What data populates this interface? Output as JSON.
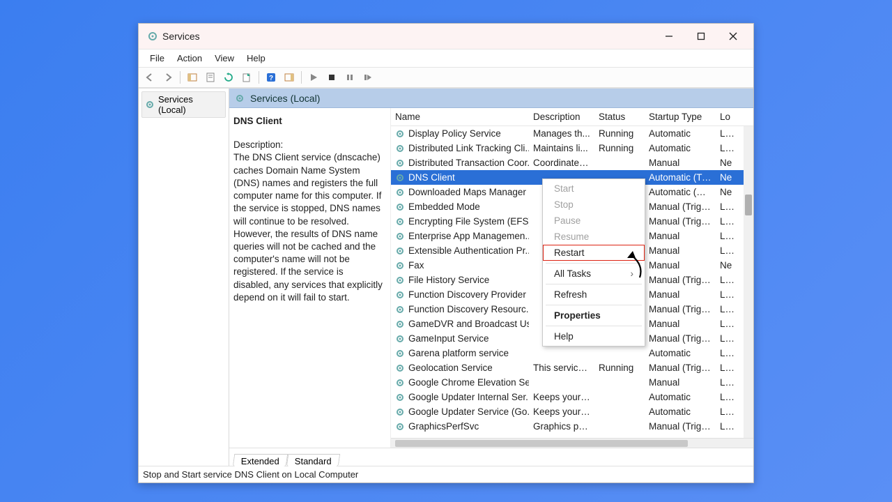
{
  "window": {
    "title": "Services"
  },
  "menus": [
    "File",
    "Action",
    "View",
    "Help"
  ],
  "tree": {
    "root": "Services (Local)"
  },
  "panel": {
    "header": "Services (Local)"
  },
  "detail": {
    "service_name": "DNS Client",
    "desc_label": "Description:",
    "description": "The DNS Client service (dnscache) caches Domain Name System (DNS) names and registers the full computer name for this computer. If the service is stopped, DNS names will continue to be resolved. However, the results of DNS name queries will not be cached and the computer's name will not be registered. If the service is disabled, any services that explicitly depend on it will fail to start."
  },
  "columns": {
    "name": "Name",
    "desc": "Description",
    "status": "Status",
    "startup": "Startup Type",
    "logon": "Lo"
  },
  "rows": [
    {
      "name": "Display Policy Service",
      "desc": "Manages th...",
      "status": "Running",
      "startup": "Automatic",
      "logon": "Loc"
    },
    {
      "name": "Distributed Link Tracking Cli...",
      "desc": "Maintains li...",
      "status": "Running",
      "startup": "Automatic",
      "logon": "Loc"
    },
    {
      "name": "Distributed Transaction Coor...",
      "desc": "Coordinates ...",
      "status": "",
      "startup": "Manual",
      "logon": "Ne"
    },
    {
      "name": "DNS Client",
      "desc": "",
      "status": "",
      "startup": "Automatic (Tri...",
      "logon": "Ne",
      "selected": true
    },
    {
      "name": "Downloaded Maps Manager",
      "desc": "",
      "status": "",
      "startup": "Automatic (De...",
      "logon": "Ne"
    },
    {
      "name": "Embedded Mode",
      "desc": "",
      "status": "",
      "startup": "Manual (Trigg...",
      "logon": "Loc"
    },
    {
      "name": "Encrypting File System (EFS)",
      "desc": "",
      "status": "",
      "startup": "Manual (Trigg...",
      "logon": "Loc"
    },
    {
      "name": "Enterprise App Managemen...",
      "desc": "",
      "status": "",
      "startup": "Manual",
      "logon": "Loc"
    },
    {
      "name": "Extensible Authentication Pr...",
      "desc": "",
      "status": "",
      "startup": "Manual",
      "logon": "Loc"
    },
    {
      "name": "Fax",
      "desc": "",
      "status": "",
      "startup": "Manual",
      "logon": "Ne"
    },
    {
      "name": "File History Service",
      "desc": "",
      "status": "",
      "startup": "Manual (Trigg...",
      "logon": "Loc"
    },
    {
      "name": "Function Discovery Provider ...",
      "desc": "",
      "status": "",
      "startup": "Manual",
      "logon": "Loc"
    },
    {
      "name": "Function Discovery Resourc...",
      "desc": "",
      "status": "",
      "startup": "Manual (Trigg...",
      "logon": "Loc"
    },
    {
      "name": "GameDVR and Broadcast Us...",
      "desc": "",
      "status": "",
      "startup": "Manual",
      "logon": "Loc"
    },
    {
      "name": "GameInput Service",
      "desc": "",
      "status": "",
      "startup": "Manual (Trigg...",
      "logon": "Loc"
    },
    {
      "name": "Garena platform service",
      "desc": "",
      "status": "",
      "startup": "Automatic",
      "logon": "Loc"
    },
    {
      "name": "Geolocation Service",
      "desc": "This service ...",
      "status": "Running",
      "startup": "Manual (Trigg...",
      "logon": "Loc"
    },
    {
      "name": "Google Chrome Elevation Se...",
      "desc": "",
      "status": "",
      "startup": "Manual",
      "logon": "Loc"
    },
    {
      "name": "Google Updater Internal Ser...",
      "desc": "Keeps your ...",
      "status": "",
      "startup": "Automatic",
      "logon": "Loc"
    },
    {
      "name": "Google Updater Service (Go...",
      "desc": "Keeps your ...",
      "status": "",
      "startup": "Automatic",
      "logon": "Loc"
    },
    {
      "name": "GraphicsPerfSvc",
      "desc": "Graphics per...",
      "status": "",
      "startup": "Manual (Trigg...",
      "logon": "Loc"
    }
  ],
  "context": {
    "start": "Start",
    "stop": "Stop",
    "pause": "Pause",
    "resume": "Resume",
    "restart": "Restart",
    "all_tasks": "All Tasks",
    "refresh": "Refresh",
    "properties": "Properties",
    "help": "Help"
  },
  "tabs": {
    "extended": "Extended",
    "standard": "Standard"
  },
  "status_text": "Stop and Start service DNS Client on Local Computer"
}
